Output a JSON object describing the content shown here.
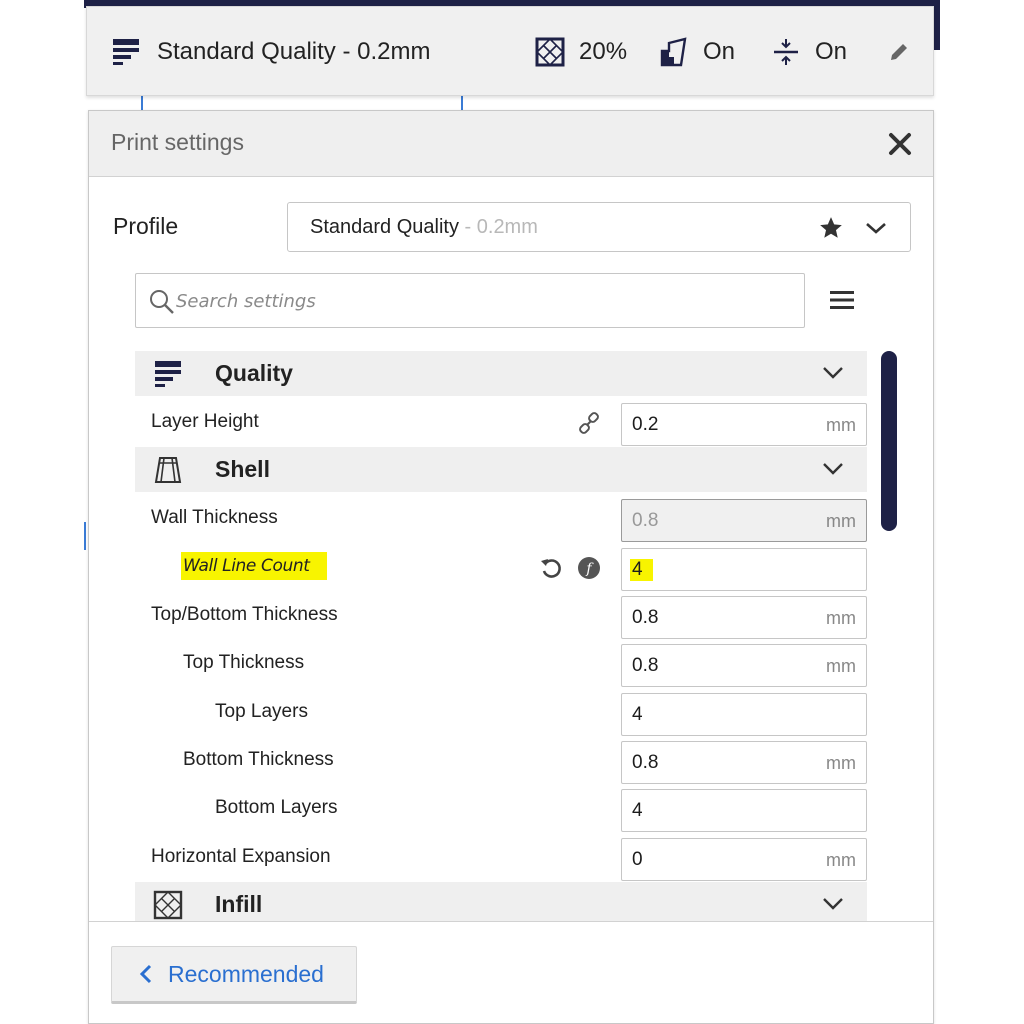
{
  "header": {
    "quality_label": "Standard Quality - 0.2mm",
    "infill_value": "20%",
    "support_value": "On",
    "adhesion_value": "On"
  },
  "panel": {
    "title": "Print settings"
  },
  "profile": {
    "label": "Profile",
    "name": "Standard Quality",
    "sub": " - 0.2mm"
  },
  "search": {
    "placeholder": "Search settings"
  },
  "categories": [
    {
      "title": "Quality",
      "icon": "quality-icon"
    },
    {
      "title": "Shell",
      "icon": "shell-icon"
    },
    {
      "title": "Infill",
      "icon": "infill-icon"
    }
  ],
  "settings": {
    "layer_height": {
      "label": "Layer Height",
      "value": "0.2",
      "unit": "mm"
    },
    "wall_thickness": {
      "label": "Wall Thickness",
      "value": "0.8",
      "unit": "mm"
    },
    "wall_line_count": {
      "label": "Wall Line Count",
      "value": "4"
    },
    "top_bottom_thickness": {
      "label": "Top/Bottom Thickness",
      "value": "0.8",
      "unit": "mm"
    },
    "top_thickness": {
      "label": "Top Thickness",
      "value": "0.8",
      "unit": "mm"
    },
    "top_layers": {
      "label": "Top Layers",
      "value": "4"
    },
    "bottom_thickness": {
      "label": "Bottom Thickness",
      "value": "0.8",
      "unit": "mm"
    },
    "bottom_layers": {
      "label": "Bottom Layers",
      "value": "4"
    },
    "horizontal_expansion": {
      "label": "Horizontal Expansion",
      "value": "0",
      "unit": "mm"
    }
  },
  "footer": {
    "recommended_label": "Recommended"
  },
  "colors": {
    "accent_dark": "#1e2146",
    "link_blue": "#2a6fd0",
    "highlight": "#f8f400"
  }
}
